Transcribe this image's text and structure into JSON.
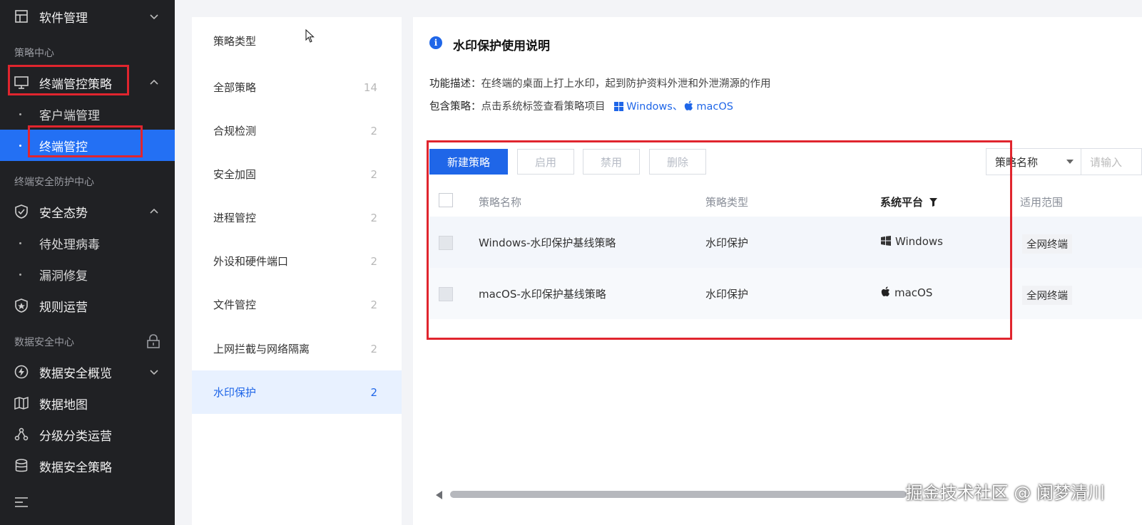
{
  "sidebar": {
    "top_item": "软件管理",
    "section_policy": "策略中心",
    "terminal_policy": "终端管控策略",
    "client_mgmt": "客户端管理",
    "terminal_control": "终端管控",
    "section_security": "终端安全防护中心",
    "security_posture": "安全态势",
    "pending_virus": "待处理病毒",
    "vuln_fix": "漏洞修复",
    "rule_ops": "规则运营",
    "section_data": "数据安全中心",
    "data_overview": "数据安全概览",
    "data_map": "数据地图",
    "classify_ops": "分级分类运营",
    "data_policy": "数据安全策略"
  },
  "categories": {
    "header": "策略类型",
    "items": [
      {
        "label": "全部策略",
        "count": "14"
      },
      {
        "label": "合规检测",
        "count": "2"
      },
      {
        "label": "安全加固",
        "count": "2"
      },
      {
        "label": "进程管控",
        "count": "2"
      },
      {
        "label": "外设和硬件端口",
        "count": "2"
      },
      {
        "label": "文件管控",
        "count": "2"
      },
      {
        "label": "上网拦截与网络隔离",
        "count": "2"
      },
      {
        "label": "水印保护",
        "count": "2"
      }
    ]
  },
  "info": {
    "title": "水印保护使用说明",
    "desc_label": "功能描述：",
    "desc_text": "在终端的桌面上打上水印，起到防护资料外泄和外泄溯源的作用",
    "incl_label": "包含策略：",
    "incl_text": "点击系统标签查看策略项目",
    "windows": "Windows",
    "sep": "、",
    "macos": "macOS"
  },
  "toolbar": {
    "new": "新建策略",
    "enable": "启用",
    "disable": "禁用",
    "delete": "删除",
    "select_value": "策略名称",
    "search_placeholder": "请输入"
  },
  "table": {
    "headers": {
      "name": "策略名称",
      "type": "策略类型",
      "platform": "系统平台",
      "scope": "适用范围"
    },
    "rows": [
      {
        "name": "Windows-水印保护基线策略",
        "type": "水印保护",
        "platform": "Windows",
        "scope": "全网终端"
      },
      {
        "name": "macOS-水印保护基线策略",
        "type": "水印保护",
        "platform": "macOS",
        "scope": "全网终端"
      }
    ]
  },
  "watermark": "掘金技术社区 @ 阑梦清川",
  "colors": {
    "accent": "#1f66e8",
    "sidebar_bg": "#202124",
    "highlight": "#e0252e"
  }
}
